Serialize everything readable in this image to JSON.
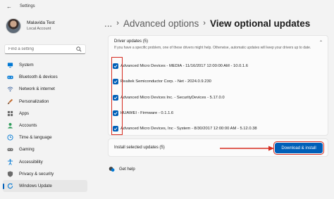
{
  "window": {
    "title": "Settings"
  },
  "profile": {
    "name": "Malavida Test",
    "subtitle": "Local Account"
  },
  "search": {
    "placeholder": "Find a setting"
  },
  "sidebar": {
    "items": [
      {
        "label": "System",
        "icon": "monitor-icon",
        "color": "#0078d4"
      },
      {
        "label": "Bluetooth & devices",
        "icon": "bluetooth-icon",
        "color": "#0078d4"
      },
      {
        "label": "Network & internet",
        "icon": "wifi-icon",
        "color": "#4a6fa5"
      },
      {
        "label": "Personalization",
        "icon": "brush-icon",
        "color": "#c36b2d"
      },
      {
        "label": "Apps",
        "icon": "apps-icon",
        "color": "#6b6b6b"
      },
      {
        "label": "Accounts",
        "icon": "person-icon",
        "color": "#2e9c5a"
      },
      {
        "label": "Time & language",
        "icon": "globe-clock-icon",
        "color": "#0078d4"
      },
      {
        "label": "Gaming",
        "icon": "gamepad-icon",
        "color": "#6b6b6b"
      },
      {
        "label": "Accessibility",
        "icon": "accessibility-icon",
        "color": "#0078d4"
      },
      {
        "label": "Privacy & security",
        "icon": "shield-icon",
        "color": "#6b6b6b"
      },
      {
        "label": "Windows Update",
        "icon": "update-icon",
        "color": "#0078d4",
        "active": true
      }
    ]
  },
  "breadcrumb": {
    "ellipsis": "...",
    "parent": "Advanced options",
    "current": "View optional updates"
  },
  "drivers": {
    "title": "Driver updates (5)",
    "description": "If you have a specific problem, one of these drivers might help. Otherwise, automatic updates will keep your drivers up to date.",
    "items": [
      {
        "label": "Advanced Micro Devices - MEDIA - 11/16/2017 12:00:00 AM - 10.0.1.6",
        "checked": true
      },
      {
        "label": "Realtek Semiconductor Corp. - Net - 2024.0.9.230",
        "checked": true
      },
      {
        "label": "Advanced Micro Devices Inc. - SecurityDevices - 5.17.0.0",
        "checked": true
      },
      {
        "label": "HUAWEI - Firmware - 0.1.1.6",
        "checked": true
      },
      {
        "label": "Advanced Micro Devices, Inc - System - 8/30/2017 12:00:00 AM - 5.12.0.38",
        "checked": true
      }
    ]
  },
  "install": {
    "text": "Install selected updates (5)",
    "button_label": "Download & install"
  },
  "help": {
    "label": "Get help"
  },
  "colors": {
    "accent": "#005fb8",
    "highlight": "#d62a1e"
  }
}
